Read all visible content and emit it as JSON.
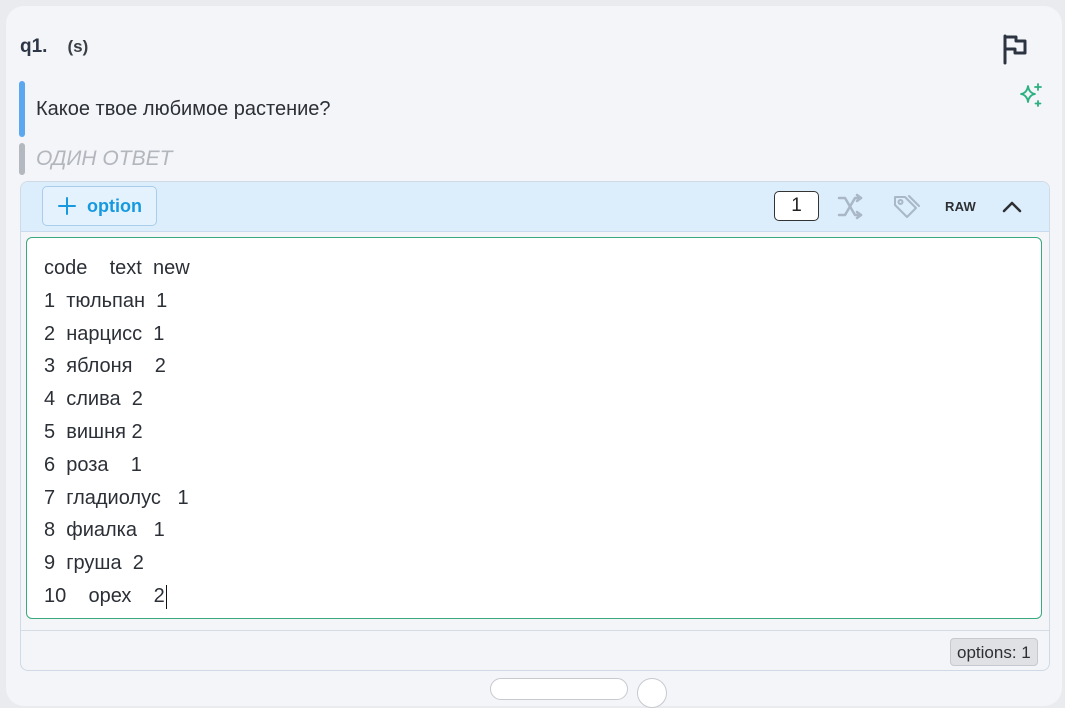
{
  "question": {
    "number": "q1.",
    "type": "(s)",
    "text": "Какое твое любимое растение?",
    "hint": "ОДИН ОТВЕТ"
  },
  "toolbar": {
    "add_label": "option",
    "count": "1",
    "raw_label": "RAW"
  },
  "editor": {
    "lines": [
      "code    text  new",
      "1  тюльпан  1",
      "2  нарцисс  1",
      "3  яблоня    2",
      "4  слива  2",
      "5  вишня 2",
      "6  роза    1",
      "7  гладиолус   1",
      "8  фиалка   1",
      "9  груша  2",
      "10    орех    2"
    ]
  },
  "footer": {
    "options_count": "options: 1"
  },
  "icons": {
    "flag": "flag-icon",
    "sparkle": "sparkle-icon",
    "plus": "plus-icon",
    "shuffle": "shuffle-icon",
    "tag": "tag-icon",
    "collapse": "chevron-up-icon"
  },
  "colors": {
    "accent_blue": "#1799e0",
    "question_bar": "#5ba7f0",
    "editor_border": "#3aaa7d",
    "sparkle": "#2bb07f"
  }
}
